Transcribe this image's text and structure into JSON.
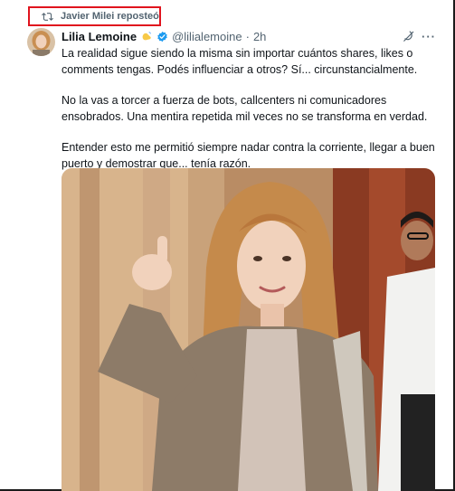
{
  "repost": {
    "text": "Javier Milei reposteó",
    "icon": "repost-icon"
  },
  "tweet": {
    "author_name": "Lilia Lemoine",
    "handle": "@lilialemoine",
    "separator": "·",
    "time": "2h",
    "paragraphs": [
      "La realidad sigue siendo la misma sin importar cuántos shares, likes o comments tengas. Podés influenciar a otros? Sí... circunstancialmente.",
      "No la vas a torcer a fuerza de bots, callcenters ni comunicadores ensobrados. Una mentira repetida mil veces no se transforma en verdad.",
      "Entender esto me permitió siempre nadar contra la corriente, llegar a buen puerto y demostrar que... tenía razón."
    ],
    "more_label": "···"
  },
  "colors": {
    "highlight_border": "#e0141e",
    "muted_text": "#536471",
    "verified": "#1d9bf0"
  }
}
